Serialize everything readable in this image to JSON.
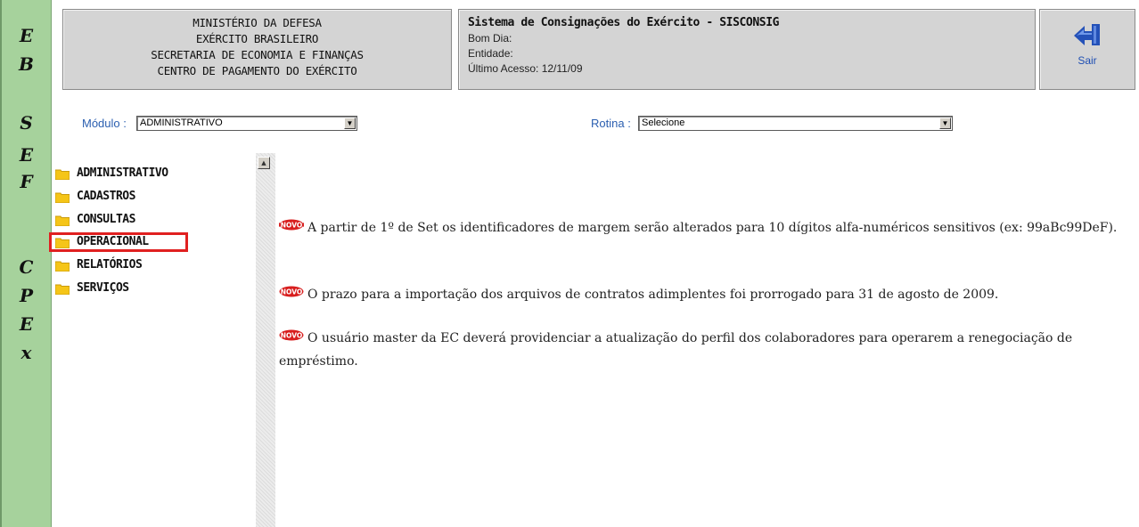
{
  "sidebar": {
    "letters": [
      "E",
      "B",
      "S",
      "E",
      "F",
      "C",
      "P",
      "E",
      "x"
    ]
  },
  "header": {
    "org_lines": [
      "MINISTÉRIO DA DEFESA",
      "EXÉRCITO BRASILEIRO",
      "SECRETARIA DE ECONOMIA E FINANÇAS",
      "CENTRO DE PAGAMENTO DO EXÉRCITO"
    ],
    "system_title": "Sistema de Consignações do Exército - SISCONSIG",
    "greeting_label": "Bom Dia:",
    "entity_label": "Entidade:",
    "last_access": "Último Acesso: 12/11/09",
    "exit_label": "Sair",
    "exit_icon": "arrow-left-icon",
    "exit_icon_color": "#1f4fb3"
  },
  "filters": {
    "modulo_label": "Módulo :",
    "modulo_value": "ADMINISTRATIVO",
    "rotina_label": "Rotina :",
    "rotina_value": "Selecione"
  },
  "tree": {
    "items": [
      "ADMINISTRATIVO",
      "CADASTROS",
      "CONSULTAS",
      "OPERACIONAL",
      "RELATÓRIOS",
      "SERVIÇOS"
    ],
    "highlighted": "OPERACIONAL",
    "highlight_color": "#e02020",
    "folder_color": "#f5c518"
  },
  "news": {
    "badge": "NOVO",
    "badge_color": "#d81e1e",
    "items": [
      "A partir de 1º de Set os identificadores de margem serão alterados para 10 dígitos alfa-numéricos sensitivos (ex: 99aBc99DeF).",
      "O prazo para a importação dos arquivos de contratos adimplentes foi prorrogado para 31 de agosto de 2009.",
      "O usuário master da EC deverá providenciar a atualização do perfil dos colaboradores para operarem a renegociação de empréstimo."
    ]
  }
}
